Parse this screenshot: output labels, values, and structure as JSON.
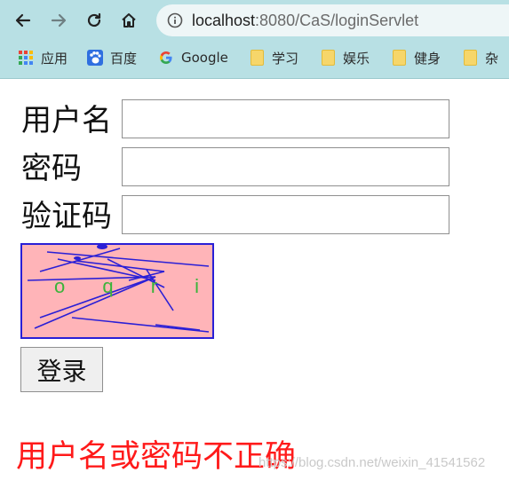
{
  "browser": {
    "url_host": "localhost",
    "url_rest": ":8080/CaS/loginServlet",
    "bookmarks": [
      {
        "label": "应用",
        "icon": "apps-grid-icon"
      },
      {
        "label": "百度",
        "icon": "baidu-paw-icon"
      },
      {
        "label": "Google",
        "icon": "google-g-icon"
      },
      {
        "label": "学习",
        "icon": "folder-icon"
      },
      {
        "label": "娱乐",
        "icon": "folder-icon"
      },
      {
        "label": "健身",
        "icon": "folder-icon"
      },
      {
        "label": "杂",
        "icon": "folder-icon"
      }
    ]
  },
  "form": {
    "username_label": "用户名",
    "username_value": "",
    "password_label": "密码",
    "password_value": "",
    "captcha_label": "验证码",
    "captcha_value": "",
    "captcha_text": "o q r i",
    "captcha_colors": {
      "background": "#ffb4b8",
      "border": "#2a1fd6",
      "text": "#3bb33b",
      "lines": "#2a1fd6"
    },
    "submit_label": "登录"
  },
  "message": {
    "error_text": "用户名或密码不正确",
    "error_color": "#ff1a1a"
  },
  "watermark": "https://blog.csdn.net/weixin_41541562"
}
